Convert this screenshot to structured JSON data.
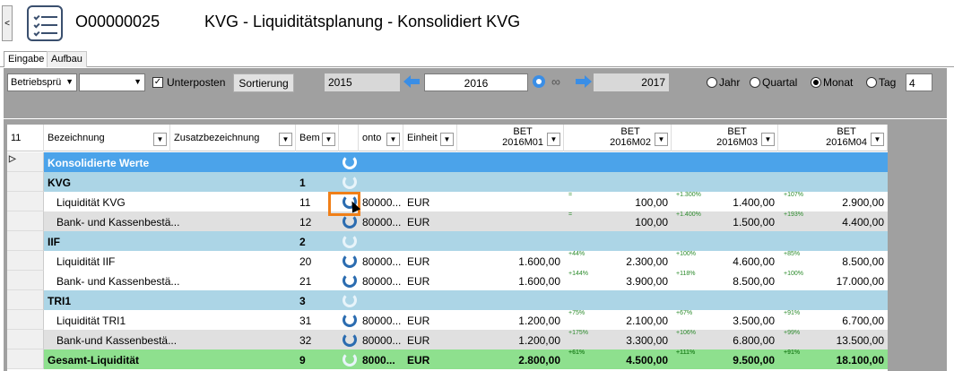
{
  "header": {
    "back": "<",
    "object_id": "O00000025",
    "title": "KVG - Liquiditätsplanung - Konsolidiert KVG"
  },
  "tabs": [
    {
      "label": "Eingabe"
    },
    {
      "label": "Aufbau"
    }
  ],
  "toolbar": {
    "combo1": "Betriebsprü",
    "combo2": "",
    "unterposten_label": "Unterposten",
    "unterposten_checked": "✓",
    "sortierung_label": "Sortierung",
    "year_from": "2015",
    "year_current": "2016",
    "year_to": "2017",
    "infinity": "∞",
    "radios": [
      {
        "label": "Jahr"
      },
      {
        "label": "Quartal"
      },
      {
        "label": "Monat"
      },
      {
        "label": "Tag"
      }
    ],
    "tag_value": "4"
  },
  "grid": {
    "columns": {
      "sel": "11",
      "bezeichnung": "Bezeichnung",
      "zusatz": "Zusatzbezeichnung",
      "bem": "Bem",
      "konto": "onto",
      "einheit": "Einheit",
      "m1_a": "BET",
      "m1_b": "2016M01",
      "m2_a": "BET",
      "m2_b": "2016M02",
      "m3_a": "BET",
      "m3_b": "2016M03",
      "m4_a": "BET",
      "m4_b": "2016M04"
    },
    "rows": [
      {
        "name": "Konsolidierte Werte",
        "bem": "",
        "konto": "",
        "einheit": "",
        "m1": "",
        "m2": "",
        "m3": "",
        "m4": "",
        "t2": "",
        "t3": "",
        "t4": ""
      },
      {
        "name": "KVG",
        "bem": "1",
        "konto": "",
        "einheit": "",
        "m1": "",
        "m2": "",
        "m3": "",
        "m4": "",
        "t2": "",
        "t3": "",
        "t4": ""
      },
      {
        "name": "Liquidität KVG",
        "bem": "11",
        "konto": "80000...",
        "einheit": "EUR",
        "m1": "",
        "m2": "100,00",
        "m3": "1.400,00",
        "m4": "2.900,00",
        "t2": "=",
        "t3": "+1.300%",
        "t4": "+107%"
      },
      {
        "name": "Bank- und Kassenbestä...",
        "bem": "12",
        "konto": "80000...",
        "einheit": "EUR",
        "m1": "",
        "m2": "100,00",
        "m3": "1.500,00",
        "m4": "4.400,00",
        "t2": "=",
        "t3": "+1.400%",
        "t4": "+193%"
      },
      {
        "name": "IIF",
        "bem": "2",
        "konto": "",
        "einheit": "",
        "m1": "",
        "m2": "",
        "m3": "",
        "m4": "",
        "t2": "",
        "t3": "",
        "t4": ""
      },
      {
        "name": "Liquidität IIF",
        "bem": "20",
        "konto": "80000...",
        "einheit": "EUR",
        "m1": "1.600,00",
        "m2": "2.300,00",
        "m3": "4.600,00",
        "m4": "8.500,00",
        "t2": "+44%",
        "t3": "+100%",
        "t4": "+85%"
      },
      {
        "name": "Bank- und Kassenbestä...",
        "bem": "21",
        "konto": "80000...",
        "einheit": "EUR",
        "m1": "1.600,00",
        "m2": "3.900,00",
        "m3": "8.500,00",
        "m4": "17.000,00",
        "t2": "+144%",
        "t3": "+118%",
        "t4": "+100%"
      },
      {
        "name": "TRI1",
        "bem": "3",
        "konto": "",
        "einheit": "",
        "m1": "",
        "m2": "",
        "m3": "",
        "m4": "",
        "t2": "",
        "t3": "",
        "t4": ""
      },
      {
        "name": "Liquidität TRI1",
        "bem": "31",
        "konto": "80000...",
        "einheit": "EUR",
        "m1": "1.200,00",
        "m2": "2.100,00",
        "m3": "3.500,00",
        "m4": "6.700,00",
        "t2": "+75%",
        "t3": "+67%",
        "t4": "+91%"
      },
      {
        "name": "Bank-und Kassenbestä...",
        "bem": "32",
        "konto": "80000...",
        "einheit": "EUR",
        "m1": "1.200,00",
        "m2": "3.300,00",
        "m3": "6.800,00",
        "m4": "13.500,00",
        "t2": "+175%",
        "t3": "+106%",
        "t4": "+99%"
      },
      {
        "name": "Gesamt-Liquidität",
        "bem": "9",
        "konto": "8000...",
        "einheit": "EUR",
        "m1": "2.800,00",
        "m2": "4.500,00",
        "m3": "9.500,00",
        "m4": "18.100,00",
        "t2": "+61%",
        "t3": "+111%",
        "t4": "+91%"
      }
    ]
  }
}
